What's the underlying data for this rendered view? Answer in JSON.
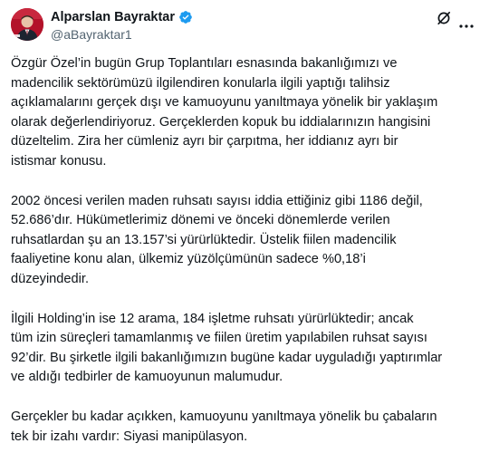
{
  "tweet": {
    "author": {
      "display_name": "Alparslan Bayraktar",
      "handle": "@aBayraktar1",
      "verified_icon": "verified-badge-icon",
      "avatar_icon": "profile-avatar"
    },
    "actions": {
      "grok_icon": "grok-icon",
      "more_icon": "more-options-icon"
    },
    "paragraphs": [
      {
        "lines": [
          "Özgür Özel’in bugün Grup Toplantıları esnasında bakanlığımızı ve",
          "madencilik sektörümüzü ilgilendiren konularla ilgili yaptığı talihsiz",
          "açıklamalarını gerçek dışı ve kamuoyunu yanıltmaya yönelik bir yaklaşım",
          "olarak değerlendiriyoruz. Gerçeklerden kopuk bu iddialarınızın hangisini",
          "düzeltelim. Zira her cümleniz ayrı bir çarpıtma, her iddianız ayrı bir",
          "istismar konusu."
        ]
      },
      {
        "lines": [
          "2002 öncesi verilen maden ruhsatı sayısı iddia ettiğiniz gibi 1186 değil,",
          "52.686’dır. Hükümetlerimiz dönemi ve önceki dönemlerde verilen",
          "ruhsatlardan şu an 13.157’si yürürlüktedir. Üstelik fiilen madencilik",
          "faaliyetine konu alan, ülkemiz yüzölçümünün sadece %0,18’i",
          "düzeyindedir."
        ]
      },
      {
        "lines": [
          "İlgili Holding’in ise 12 arama, 184 işletme ruhsatı yürürlüktedir; ancak",
          "tüm izin süreçleri tamamlanmış ve fiilen üretim yapılabilen ruhsat sayısı",
          "92’dir. Bu şirketle ilgili bakanlığımızın bugüne kadar uyguladığı yaptırımlar",
          "ve aldığı tedbirler de kamuoyunun malumudur."
        ]
      },
      {
        "lines": [
          "Gerçekler bu kadar açıkken, kamuoyunu yanıltmaya yönelik bu çabaların",
          "tek bir izahı vardır: Siyasi manipülasyon."
        ]
      }
    ],
    "colors": {
      "text": "#0f1419",
      "secondary": "#536471",
      "verified": "#1d9bf0",
      "avatar_bg": "#b3122a"
    }
  }
}
